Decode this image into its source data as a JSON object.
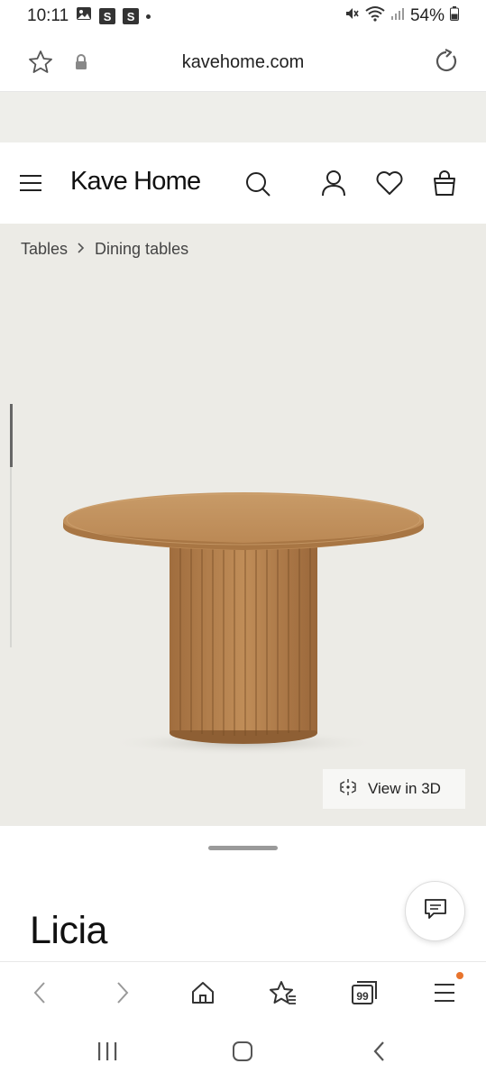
{
  "status": {
    "time": "10:11",
    "battery": "54%",
    "notif_s1": "S",
    "notif_s2": "S"
  },
  "browser": {
    "url": "kavehome.com"
  },
  "site": {
    "logo": "Kave Home",
    "breadcrumb": [
      "Tables",
      "Dining tables"
    ],
    "view3d_label": "View in 3D"
  },
  "product": {
    "name": "Licia"
  },
  "toolbar": {
    "tabs_count": "99"
  },
  "colors": {
    "product_bg": "#ecebe6",
    "wood": "#b98a57",
    "badge": "#e8742d"
  }
}
